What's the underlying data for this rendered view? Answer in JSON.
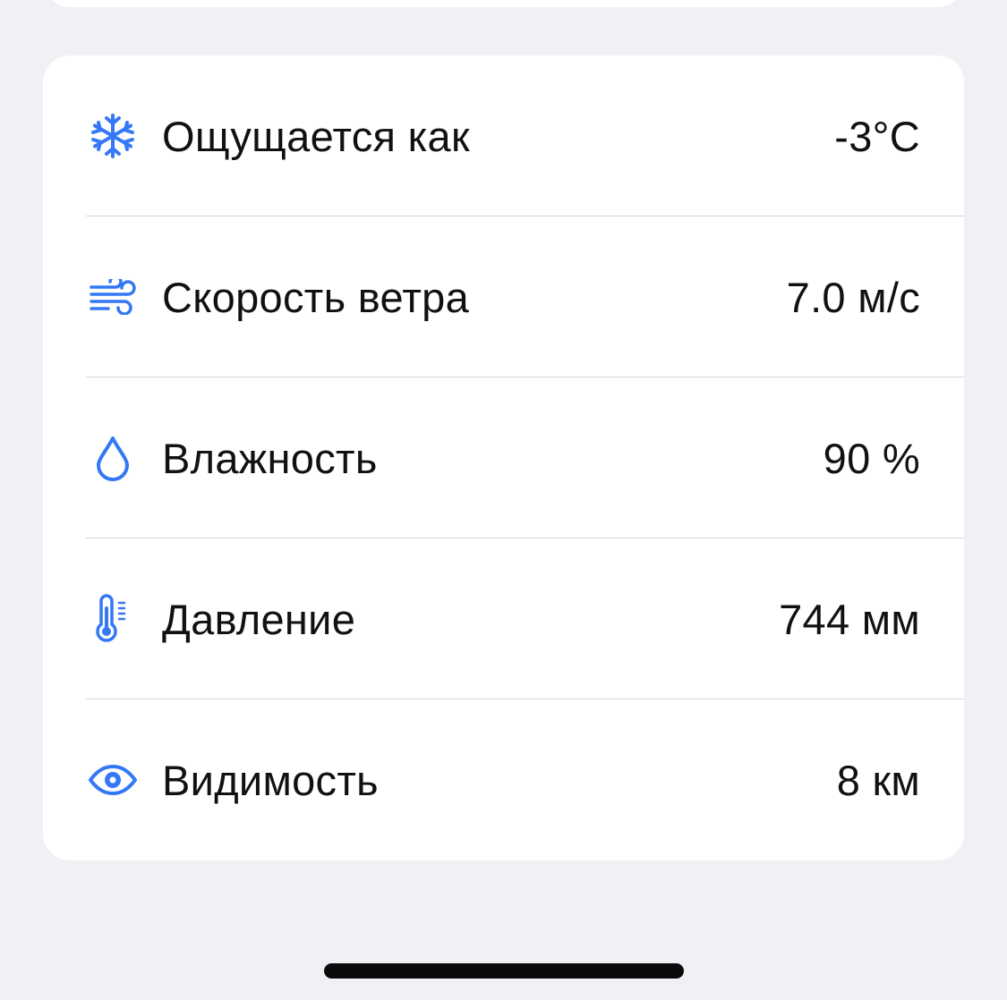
{
  "accent_color": "#3478f6",
  "details": [
    {
      "icon": "snowflake-icon",
      "label": "Ощущается как",
      "value": "-3°C"
    },
    {
      "icon": "wind-icon",
      "label": "Скорость ветра",
      "value": "7.0 м/с"
    },
    {
      "icon": "droplet-icon",
      "label": "Влажность",
      "value": "90 %"
    },
    {
      "icon": "thermometer-icon",
      "label": "Давление",
      "value": "744 мм"
    },
    {
      "icon": "eye-icon",
      "label": "Видимость",
      "value": "8 км"
    }
  ]
}
